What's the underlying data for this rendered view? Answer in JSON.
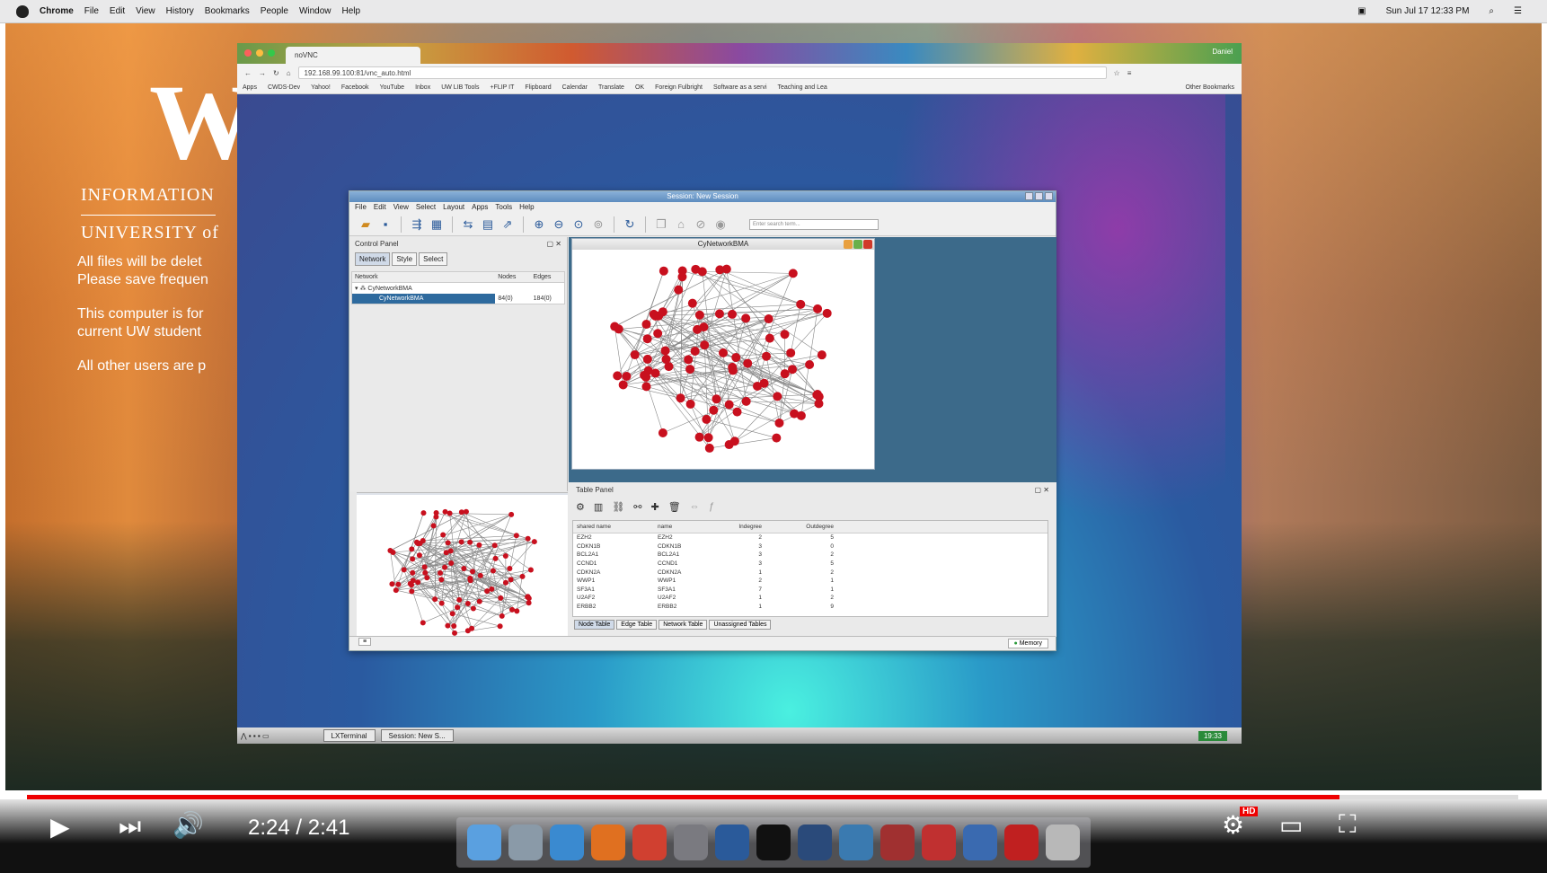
{
  "macbar": {
    "app": "Chrome",
    "menus": [
      "File",
      "Edit",
      "View",
      "History",
      "Bookmarks",
      "People",
      "Window",
      "Help"
    ],
    "clock": "Sun Jul 17  12:33 PM",
    "user_icon": "flag-icon"
  },
  "desktop": {
    "logo": "W",
    "line1": "INFORMATION",
    "line2": "UNIVERSITY of",
    "notes": [
      "All files will be delet Please save frequen",
      "This computer is for current UW student",
      "All other users are p"
    ]
  },
  "chrome": {
    "tab_title": "noVNC",
    "user": "Daniel",
    "url": "192.168.99.100:81/vnc_auto.html",
    "bookmarks": [
      "Apps",
      "CWDS-Dev",
      "Yahoo!",
      "Facebook",
      "YouTube",
      "Inbox",
      "UW LIB Tools",
      "+FLIP IT",
      "Flipboard",
      "Calendar",
      "Translate",
      "OK",
      "Foreign Fulbright",
      "Software as a servi",
      "Teaching and Lea",
      "Other Bookmarks"
    ]
  },
  "cytoscape": {
    "title": "Session: New Session",
    "menus": [
      "File",
      "Edit",
      "View",
      "Select",
      "Layout",
      "Apps",
      "Tools",
      "Help"
    ],
    "search_placeholder": "Enter search term...",
    "control_panel": {
      "title": "Control Panel",
      "tabs": [
        "Network",
        "Style",
        "Select"
      ],
      "columns": [
        "Network",
        "Nodes",
        "Edges"
      ],
      "rows": [
        {
          "name": "CyNetworkBMA",
          "nodes": "",
          "edges": ""
        },
        {
          "name": "CyNetworkBMA",
          "nodes": "84(0)",
          "edges": "184(0)"
        }
      ]
    },
    "network_window": {
      "title": "CyNetworkBMA"
    },
    "table_panel": {
      "title": "Table Panel",
      "columns": [
        "shared name",
        "name",
        "Indegree",
        "Outdegree"
      ],
      "rows": [
        [
          "EZH2",
          "EZH2",
          "2",
          "5"
        ],
        [
          "CDKN1B",
          "CDKN1B",
          "3",
          "0"
        ],
        [
          "BCL2A1",
          "BCL2A1",
          "3",
          "2"
        ],
        [
          "CCND1",
          "CCND1",
          "3",
          "5"
        ],
        [
          "CDKN2A",
          "CDKN2A",
          "1",
          "2"
        ],
        [
          "WWP1",
          "WWP1",
          "2",
          "1"
        ],
        [
          "SF3A1",
          "SF3A1",
          "7",
          "1"
        ],
        [
          "U2AF2",
          "U2AF2",
          "1",
          "2"
        ],
        [
          "ERBB2",
          "ERBB2",
          "1",
          "9"
        ]
      ],
      "tabs": [
        "Node Table",
        "Edge Table",
        "Network Table",
        "Unassigned Tables"
      ]
    },
    "memory": "Memory"
  },
  "lxde": {
    "tasks": [
      "LXTerminal",
      "Session: New S..."
    ],
    "clock": "19:33"
  },
  "player": {
    "time": "2:24 / 2:41",
    "progress": 0.88,
    "quality": "HD"
  }
}
